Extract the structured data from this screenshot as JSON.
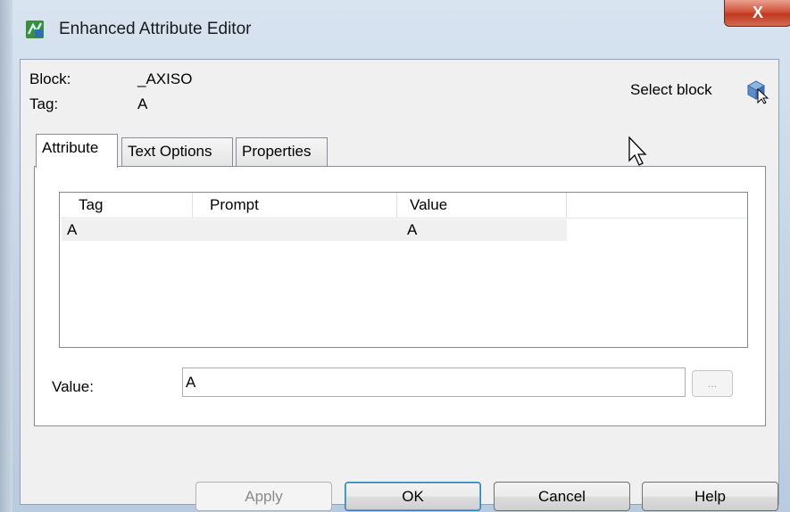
{
  "window": {
    "title": "Enhanced Attribute Editor",
    "close_label": "X"
  },
  "info": {
    "block_label": "Block:",
    "block_value": "_AXISO",
    "tag_label": "Tag:",
    "tag_value": "A",
    "select_block_label": "Select block"
  },
  "tabs": [
    {
      "label": "Attribute",
      "active": true
    },
    {
      "label": "Text Options",
      "active": false
    },
    {
      "label": "Properties",
      "active": false
    }
  ],
  "list": {
    "columns": [
      "Tag",
      "Prompt",
      "Value"
    ],
    "rows": [
      {
        "tag": "A",
        "prompt": "",
        "value": "A"
      }
    ]
  },
  "value_field": {
    "label": "Value:",
    "value": "A",
    "browse_label": "..."
  },
  "buttons": {
    "apply": "Apply",
    "ok": "OK",
    "cancel": "Cancel",
    "help": "Help"
  }
}
